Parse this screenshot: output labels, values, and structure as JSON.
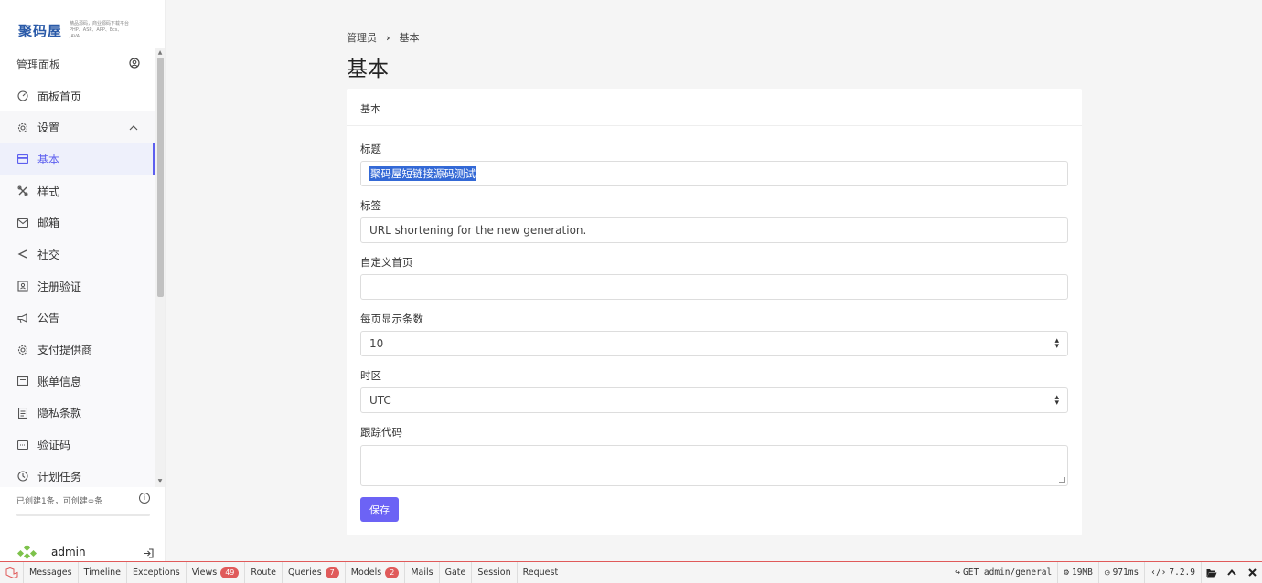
{
  "logo": {
    "main": "聚码屋",
    "sub": "精品源码，商业源码下载平台 PHP、ASP、APP、Ecs、JAVA…"
  },
  "sidebar": {
    "header": {
      "label": "管理面板"
    },
    "items": [
      {
        "label": "面板首页",
        "icon": "dashboard-icon"
      },
      {
        "label": "设置",
        "icon": "settings-icon"
      },
      {
        "label": "基本",
        "icon": "card-icon"
      },
      {
        "label": "样式",
        "icon": "style-icon"
      },
      {
        "label": "邮箱",
        "icon": "mail-icon"
      },
      {
        "label": "社交",
        "icon": "share-icon"
      },
      {
        "label": "注册验证",
        "icon": "id-card-icon"
      },
      {
        "label": "公告",
        "icon": "megaphone-icon"
      },
      {
        "label": "支付提供商",
        "icon": "gear-icon"
      },
      {
        "label": "账单信息",
        "icon": "invoice-icon"
      },
      {
        "label": "隐私条款",
        "icon": "document-icon"
      },
      {
        "label": "验证码",
        "icon": "captcha-icon"
      },
      {
        "label": "计划任务",
        "icon": "clock-icon"
      }
    ],
    "quota": "已创建1条，可创建∞条",
    "user": {
      "name": "admin"
    }
  },
  "breadcrumb": {
    "parent": "管理员",
    "current": "基本"
  },
  "page": {
    "title": "基本"
  },
  "card": {
    "header": "基本",
    "fields": {
      "title": {
        "label": "标题",
        "value": "聚码屋短链接源码测试"
      },
      "tagline": {
        "label": "标签",
        "value": "URL shortening for the new generation."
      },
      "custom_index": {
        "label": "自定义首页",
        "value": ""
      },
      "per_page": {
        "label": "每页显示条数",
        "value": "10"
      },
      "timezone": {
        "label": "时区",
        "value": "UTC"
      },
      "tracking": {
        "label": "跟踪代码",
        "value": ""
      }
    },
    "save_label": "保存"
  },
  "debugbar": {
    "tabs": [
      {
        "label": "Messages"
      },
      {
        "label": "Timeline"
      },
      {
        "label": "Exceptions"
      },
      {
        "label": "Views",
        "badge": "49"
      },
      {
        "label": "Route"
      },
      {
        "label": "Queries",
        "badge": "7"
      },
      {
        "label": "Models",
        "badge": "2"
      },
      {
        "label": "Mails"
      },
      {
        "label": "Gate"
      },
      {
        "label": "Session"
      },
      {
        "label": "Request"
      }
    ],
    "request": "GET admin/general",
    "memory": "19MB",
    "time": "971ms",
    "php_version": "7.2.9"
  },
  "colors": {
    "accent": "#5d5fef",
    "button": "#6c63f5",
    "debug_red": "#e05a5a"
  }
}
